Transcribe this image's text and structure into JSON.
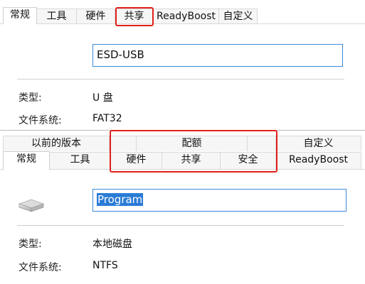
{
  "top_panel": {
    "tabs": [
      "常规",
      "工具",
      "硬件",
      "共享",
      "ReadyBoost",
      "自定义"
    ],
    "name_value": "ESD-USB",
    "type_label": "类型:",
    "type_value": "U 盘",
    "fs_label": "文件系统:",
    "fs_value": "FAT32"
  },
  "bottom_panel": {
    "tabs_row1": [
      "以前的版本",
      "配额",
      "自定义"
    ],
    "tabs_row2": [
      "常规",
      "工具",
      "硬件",
      "共享",
      "安全",
      "ReadyBoost"
    ],
    "name_value": "Program",
    "type_label": "类型:",
    "type_value": "本地磁盘",
    "fs_label": "文件系统:",
    "fs_value": "NTFS"
  },
  "colors": {
    "highlight": "#e0201b",
    "selection": "#2a7bd6",
    "field_border": "#3b8ad8"
  },
  "icons": {
    "drive": "drive-icon"
  }
}
